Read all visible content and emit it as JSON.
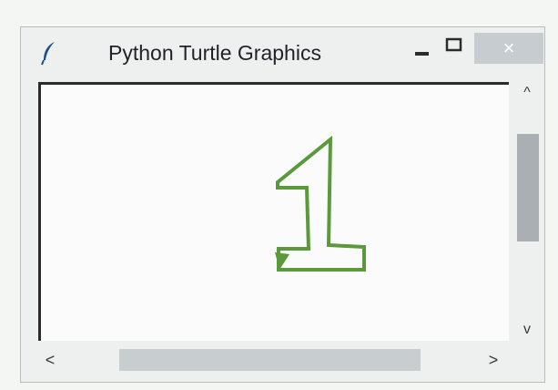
{
  "window": {
    "title": "Python Turtle Graphics",
    "controls": {
      "minimize_icon": "minimize-icon",
      "maximize_icon": "maximize-icon",
      "close_icon": "close-icon",
      "close_glyph": "×"
    }
  },
  "canvas": {
    "drawing": "digit-1-outline",
    "stroke_color": "#5a9a3a",
    "background": "#fbfbfb"
  },
  "scrollbars": {
    "vertical": {
      "up_glyph": "^",
      "down_glyph": "v"
    },
    "horizontal": {
      "left_glyph": "<",
      "right_glyph": ">"
    }
  },
  "colors": {
    "window_bg": "#eef0ef",
    "close_button_bg": "#c7ccd0",
    "scroll_thumb": "#a9afb3"
  }
}
